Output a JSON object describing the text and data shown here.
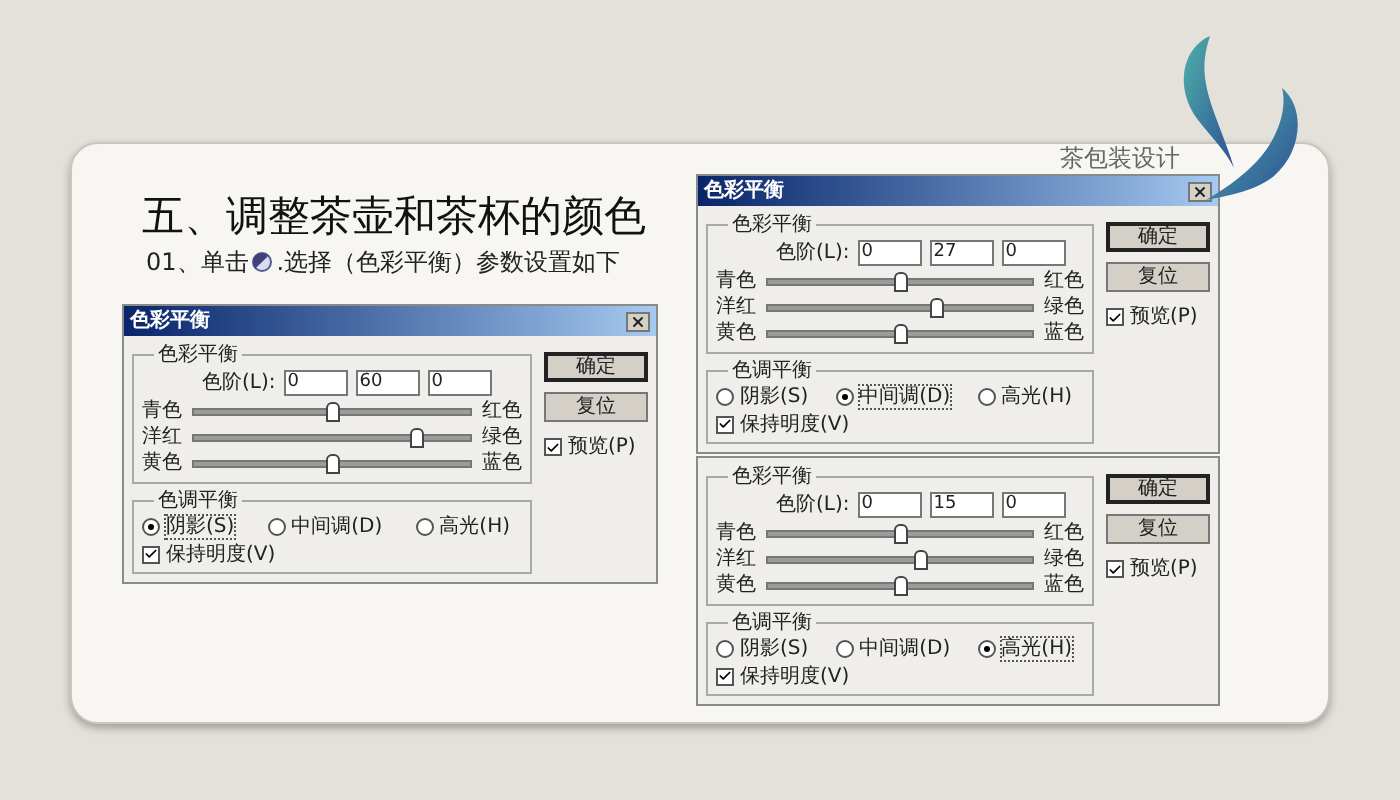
{
  "slide": {
    "header": "茶包装设计",
    "title": "五、调整茶壶和茶杯的颜色",
    "step_prefix": "01、单击",
    "step_suffix": ".选择（色彩平衡）参数设置如下"
  },
  "dialogs": [
    {
      "title": "色彩平衡",
      "group_label": "色彩平衡",
      "levels_label": "色阶(L):",
      "levels": [
        "0",
        "60",
        "0"
      ],
      "sliders": [
        {
          "left": "青色",
          "right": "红色",
          "level": 0.5
        },
        {
          "left": "洋红",
          "right": "绿色",
          "level": 0.8
        },
        {
          "left": "黄色",
          "right": "蓝色",
          "level": 0.5
        }
      ],
      "tone_label": "色调平衡",
      "tones": [
        {
          "label": "阴影(S)",
          "selected": true
        },
        {
          "label": "中间调(D)",
          "selected": false
        },
        {
          "label": "高光(H)",
          "selected": false
        }
      ],
      "preserve": {
        "label": "保持明度(V)",
        "checked": true
      },
      "buttons": [
        "确定",
        "复位"
      ],
      "preview": {
        "label": "预览(P)",
        "checked": true
      }
    },
    {
      "title": "色彩平衡",
      "group_label": "色彩平衡",
      "levels_label": "色阶(L):",
      "levels": [
        "0",
        "27",
        "0"
      ],
      "sliders": [
        {
          "left": "青色",
          "right": "红色",
          "level": 0.5
        },
        {
          "left": "洋红",
          "right": "绿色",
          "level": 0.635
        },
        {
          "left": "黄色",
          "right": "蓝色",
          "level": 0.5
        }
      ],
      "tone_label": "色调平衡",
      "tones": [
        {
          "label": "阴影(S)",
          "selected": false
        },
        {
          "label": "中间调(D)",
          "selected": true
        },
        {
          "label": "高光(H)",
          "selected": false
        }
      ],
      "preserve": {
        "label": "保持明度(V)",
        "checked": true
      },
      "buttons": [
        "确定",
        "复位"
      ],
      "preview": {
        "label": "预览(P)",
        "checked": true
      }
    },
    {
      "group_label": "色彩平衡",
      "levels_label": "色阶(L):",
      "levels": [
        "0",
        "15",
        "0"
      ],
      "sliders": [
        {
          "left": "青色",
          "right": "红色",
          "level": 0.5
        },
        {
          "left": "洋红",
          "right": "绿色",
          "level": 0.575
        },
        {
          "left": "黄色",
          "right": "蓝色",
          "level": 0.5
        }
      ],
      "tone_label": "色调平衡",
      "tones": [
        {
          "label": "阴影(S)",
          "selected": false
        },
        {
          "label": "中间调(D)",
          "selected": false
        },
        {
          "label": "高光(H)",
          "selected": true
        }
      ],
      "preserve": {
        "label": "保持明度(V)",
        "checked": true
      },
      "buttons": [
        "确定",
        "复位"
      ],
      "preview": {
        "label": "预览(P)",
        "checked": true
      }
    }
  ]
}
